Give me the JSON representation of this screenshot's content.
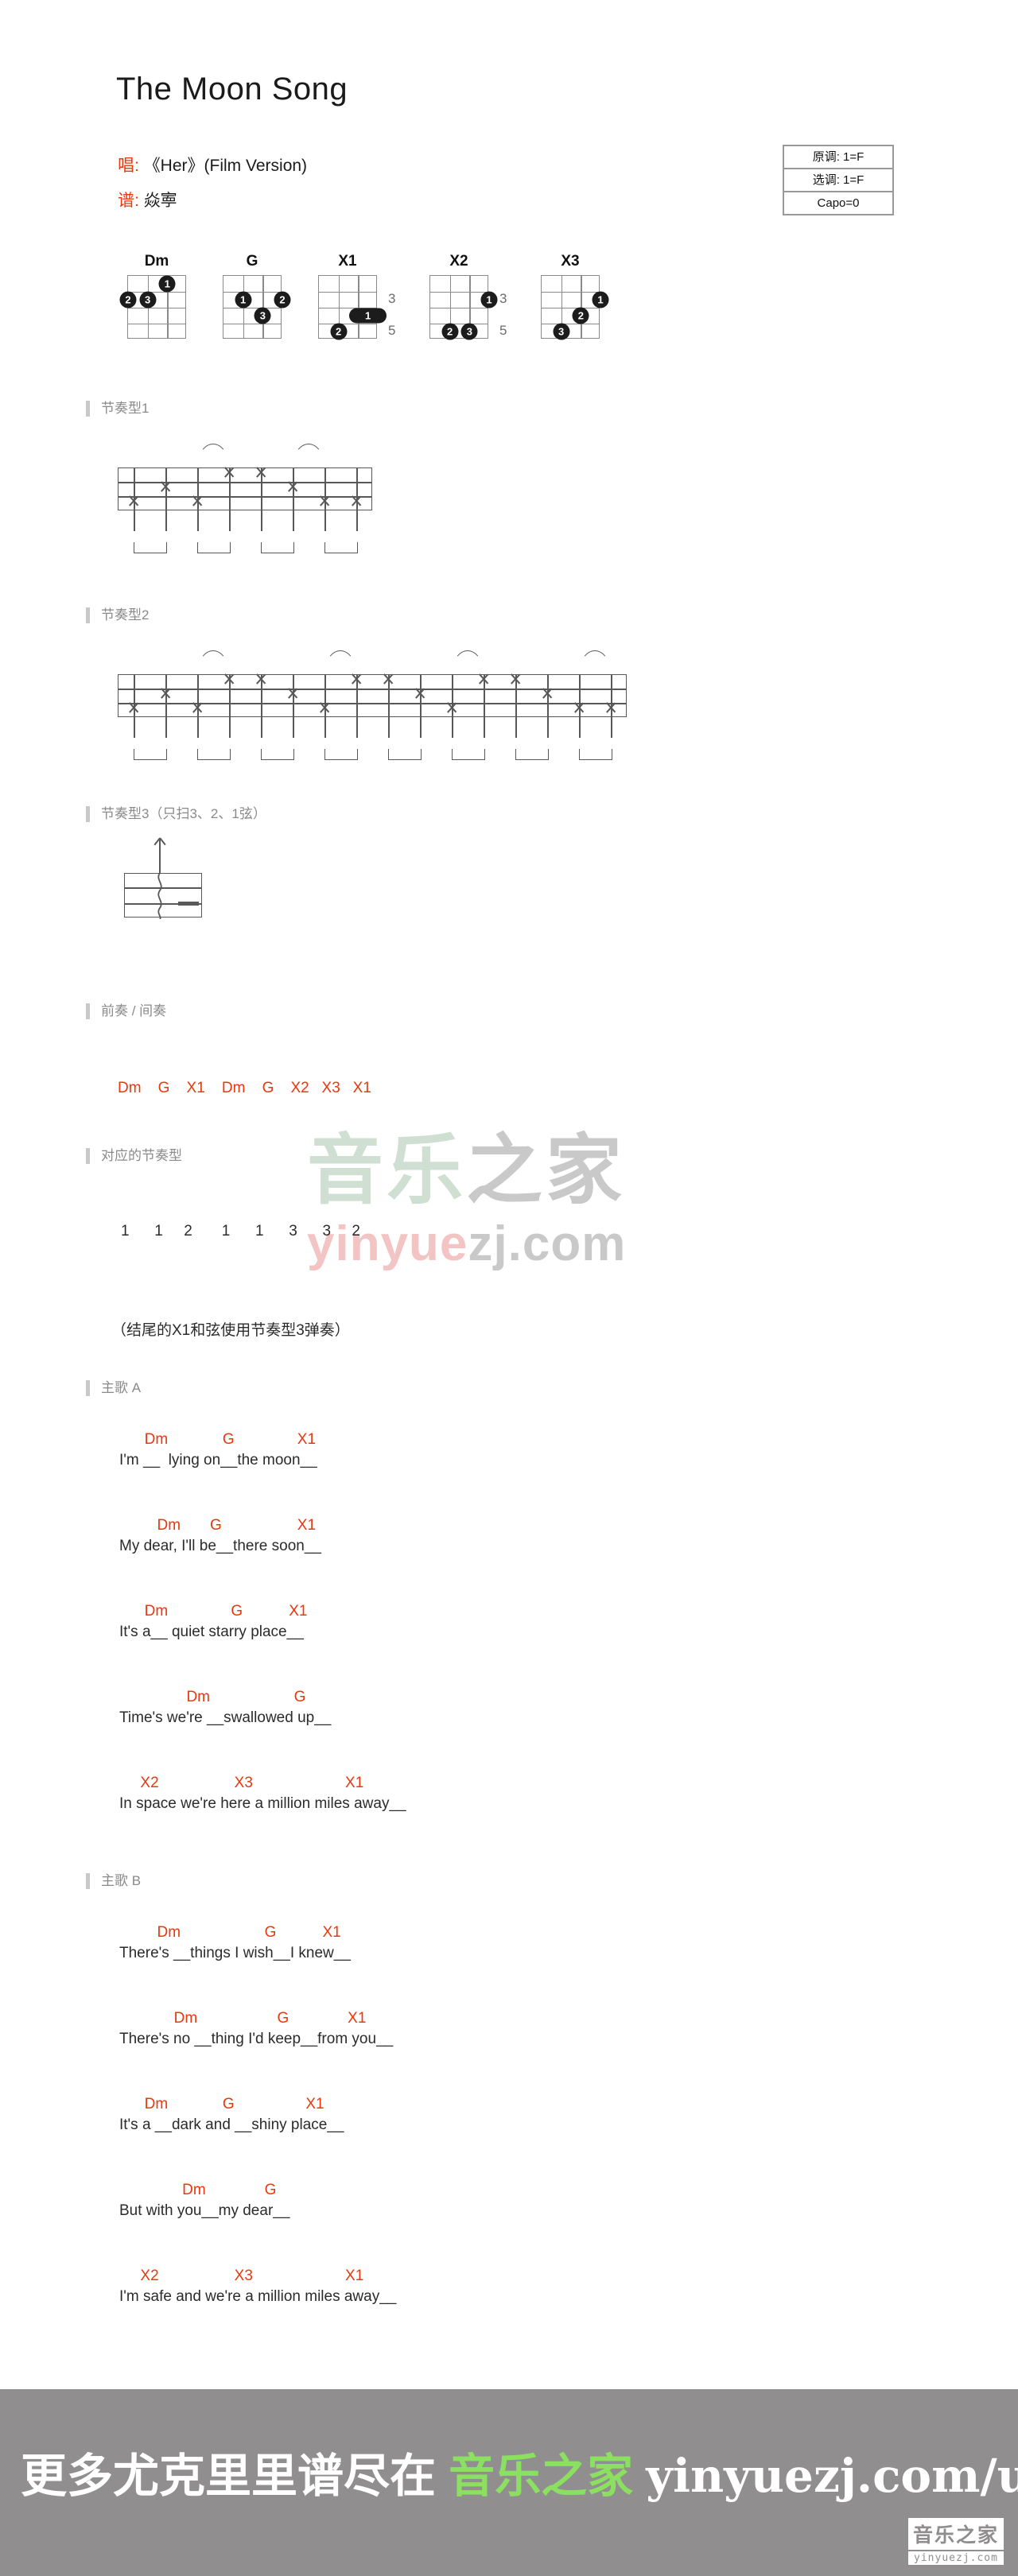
{
  "header": {
    "title": "The Moon Song",
    "singer_label": "唱:",
    "singer_value": "《Her》(Film Version)",
    "arranger_label": "谱:",
    "arranger_value": "焱寕"
  },
  "keybox": {
    "original_key": "原调: 1=F",
    "play_key": "选调: 1=F",
    "capo": "Capo=0"
  },
  "chords": [
    {
      "name": "Dm",
      "start_fret": "",
      "fret_marks": [],
      "dots": [
        {
          "string": 3,
          "fret": 1,
          "finger": "1"
        },
        {
          "string": 1,
          "fret": 2,
          "finger": "2"
        },
        {
          "string": 2,
          "fret": 2,
          "finger": "3"
        }
      ],
      "bars": []
    },
    {
      "name": "G",
      "start_fret": "",
      "fret_marks": [],
      "dots": [
        {
          "string": 2,
          "fret": 2,
          "finger": "1"
        },
        {
          "string": 4,
          "fret": 2,
          "finger": "2"
        },
        {
          "string": 3,
          "fret": 3,
          "finger": "3"
        }
      ],
      "bars": []
    },
    {
      "name": "X1",
      "start_fret": "",
      "fret_marks": [
        "3",
        "5"
      ],
      "dots": [
        {
          "string": 2,
          "fret": 4,
          "finger": "2"
        }
      ],
      "bars": [
        {
          "fret": 3,
          "from_string": 3,
          "to_string": 4,
          "finger": "1"
        }
      ]
    },
    {
      "name": "X2",
      "start_fret": "",
      "fret_marks": [
        "3",
        "5"
      ],
      "dots": [
        {
          "string": 4,
          "fret": 2,
          "finger": "1"
        },
        {
          "string": 2,
          "fret": 4,
          "finger": "2"
        },
        {
          "string": 3,
          "fret": 4,
          "finger": "3"
        }
      ],
      "bars": []
    },
    {
      "name": "X3",
      "start_fret": "",
      "fret_marks": [],
      "dots": [
        {
          "string": 4,
          "fret": 2,
          "finger": "1"
        },
        {
          "string": 3,
          "fret": 3,
          "finger": "2"
        },
        {
          "string": 2,
          "fret": 4,
          "finger": "3"
        }
      ],
      "bars": []
    }
  ],
  "sections": {
    "rhythm1": "节奏型1",
    "rhythm2": "节奏型2",
    "rhythm3": "节奏型3（只扫3、2、1弦）",
    "intro": "前奏 / 间奏",
    "pattern_map": "对应的节奏型",
    "verse_a": "主歌 A",
    "verse_b": "主歌 B"
  },
  "rhythm1": {
    "strums": [
      {
        "beat": 0,
        "string": 3
      },
      {
        "beat": 1,
        "string": 2
      },
      {
        "beat": 2,
        "string": 3
      },
      {
        "beat": 3,
        "string": 1
      },
      {
        "beat": 4,
        "string": 1
      },
      {
        "beat": 5,
        "string": 2
      },
      {
        "beat": 6,
        "string": 3
      },
      {
        "beat": 7,
        "string": 3
      }
    ],
    "slurs": [
      3,
      6
    ],
    "groups": 4
  },
  "rhythm2": {
    "strums": [
      {
        "beat": 0,
        "string": 3
      },
      {
        "beat": 1,
        "string": 2
      },
      {
        "beat": 2,
        "string": 3
      },
      {
        "beat": 3,
        "string": 1
      },
      {
        "beat": 4,
        "string": 1
      },
      {
        "beat": 5,
        "string": 2
      },
      {
        "beat": 6,
        "string": 3
      },
      {
        "beat": 7,
        "string": 1
      },
      {
        "beat": 8,
        "string": 1
      },
      {
        "beat": 9,
        "string": 2
      },
      {
        "beat": 10,
        "string": 3
      },
      {
        "beat": 11,
        "string": 1
      },
      {
        "beat": 12,
        "string": 1
      },
      {
        "beat": 13,
        "string": 2
      },
      {
        "beat": 14,
        "string": 3
      },
      {
        "beat": 15,
        "string": 3
      }
    ],
    "slurs": [
      3,
      7,
      11,
      15
    ],
    "groups": 8
  },
  "intro": {
    "chords": "Dm    G    X1    Dm    G    X2   X3   X1",
    "pattern_numbers": "1      1     2       1      1      3      3     2",
    "note": "（结尾的X1和弦使用节奏型3弹奏）"
  },
  "verse_a": [
    {
      "chords": "      Dm             G               X1",
      "lyrics": "I'm __  lying on__the moon__"
    },
    {
      "chords": "         Dm       G                  X1",
      "lyrics": "My dear, I'll be__there soon__"
    },
    {
      "chords": "      Dm               G           X1",
      "lyrics": "It's a__ quiet starry place__"
    },
    {
      "chords": "                Dm                    G",
      "lyrics": "Time's we're __swallowed up__"
    },
    {
      "chords": "     X2                  X3                      X1",
      "lyrics": "In space we're here a million miles away__"
    }
  ],
  "verse_b": [
    {
      "chords": "         Dm                    G           X1",
      "lyrics": "There's __things I wish__I knew__"
    },
    {
      "chords": "             Dm                   G              X1",
      "lyrics": "There's no __thing I'd keep__from you__"
    },
    {
      "chords": "      Dm             G                 X1",
      "lyrics": "It's a __dark and __shiny place__"
    },
    {
      "chords": "               Dm              G",
      "lyrics": "But with you__my dear__"
    },
    {
      "chords": "     X2                  X3                      X1",
      "lyrics": "I'm safe and we're a million miles away__"
    }
  ],
  "watermark": {
    "cn_green": "音乐",
    "cn_grey": "之家",
    "en_pink": "yinyue",
    "en_grey": "zj.com"
  },
  "footer": {
    "lead": "更多尤克里里谱尽在",
    "brand": "音乐之家",
    "url": "yinyuezj.com/ukulele",
    "logo_cn": "音乐之家",
    "logo_en": "yinyuezj.com"
  }
}
